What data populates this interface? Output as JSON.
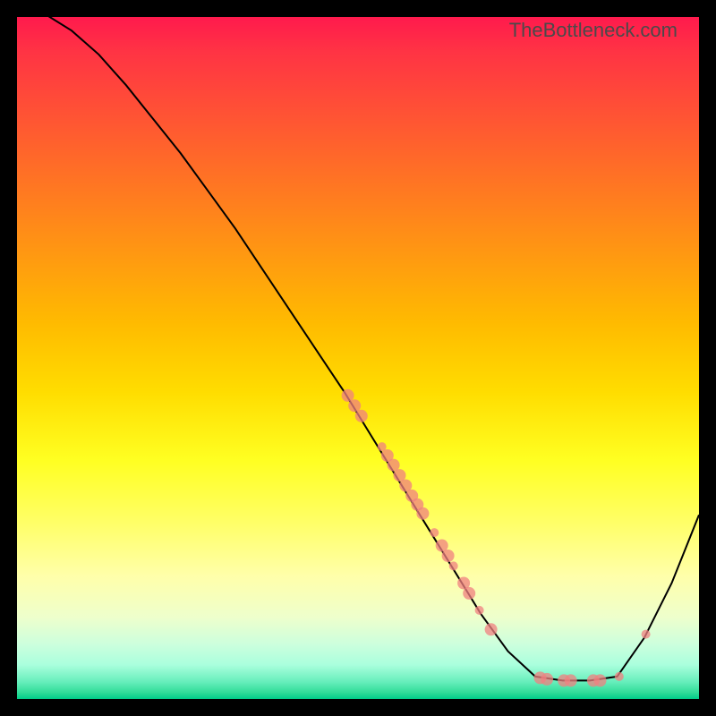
{
  "watermark": "TheBottleneck.com",
  "chart_data": {
    "type": "line",
    "title": "",
    "xlabel": "",
    "ylabel": "",
    "xlim": [
      0,
      100
    ],
    "ylim": [
      0,
      100
    ],
    "series": [
      {
        "name": "bottleneck-curve",
        "x": [
          0,
          4,
          8,
          12,
          16,
          20,
          24,
          28,
          32,
          36,
          40,
          44,
          48,
          52,
          56,
          60,
          64,
          68,
          72,
          76,
          80,
          84,
          88,
          92,
          96,
          100
        ],
        "y": [
          102,
          100.5,
          98,
          94.5,
          90,
          85,
          80,
          74.5,
          69,
          63,
          57,
          51,
          45,
          38.5,
          32,
          25.5,
          19,
          12.5,
          7,
          3.3,
          2.7,
          2.7,
          3.3,
          9,
          17,
          27
        ]
      }
    ],
    "scatter_points": {
      "name": "highlight-dots",
      "points": [
        {
          "x": 48.5,
          "y": 44.5,
          "r": 7
        },
        {
          "x": 49.5,
          "y": 43,
          "r": 7
        },
        {
          "x": 50.5,
          "y": 41.5,
          "r": 7
        },
        {
          "x": 53.5,
          "y": 37,
          "r": 5
        },
        {
          "x": 54.3,
          "y": 35.7,
          "r": 7
        },
        {
          "x": 55.2,
          "y": 34.3,
          "r": 7
        },
        {
          "x": 56.1,
          "y": 32.8,
          "r": 7
        },
        {
          "x": 57.0,
          "y": 31.3,
          "r": 7
        },
        {
          "x": 57.9,
          "y": 29.8,
          "r": 7
        },
        {
          "x": 58.7,
          "y": 28.5,
          "r": 7
        },
        {
          "x": 59.5,
          "y": 27.2,
          "r": 7
        },
        {
          "x": 61.2,
          "y": 24.4,
          "r": 5
        },
        {
          "x": 62.3,
          "y": 22.5,
          "r": 7
        },
        {
          "x": 63.2,
          "y": 21,
          "r": 7
        },
        {
          "x": 64.0,
          "y": 19.5,
          "r": 5
        },
        {
          "x": 65.5,
          "y": 17,
          "r": 7
        },
        {
          "x": 66.3,
          "y": 15.5,
          "r": 7
        },
        {
          "x": 67.8,
          "y": 13,
          "r": 5
        },
        {
          "x": 69.5,
          "y": 10.2,
          "r": 7
        },
        {
          "x": 76.7,
          "y": 3.1,
          "r": 7
        },
        {
          "x": 77.7,
          "y": 2.9,
          "r": 7
        },
        {
          "x": 80.2,
          "y": 2.7,
          "r": 7
        },
        {
          "x": 81.2,
          "y": 2.7,
          "r": 7
        },
        {
          "x": 84.5,
          "y": 2.7,
          "r": 7
        },
        {
          "x": 85.5,
          "y": 2.7,
          "r": 7
        },
        {
          "x": 88.3,
          "y": 3.3,
          "r": 5
        },
        {
          "x": 92.2,
          "y": 9.5,
          "r": 5
        }
      ]
    },
    "colors": {
      "curve": "#000000",
      "dots": "#f08080",
      "gradient_top": "#ff1a4d",
      "gradient_bottom": "#00cc88"
    }
  }
}
